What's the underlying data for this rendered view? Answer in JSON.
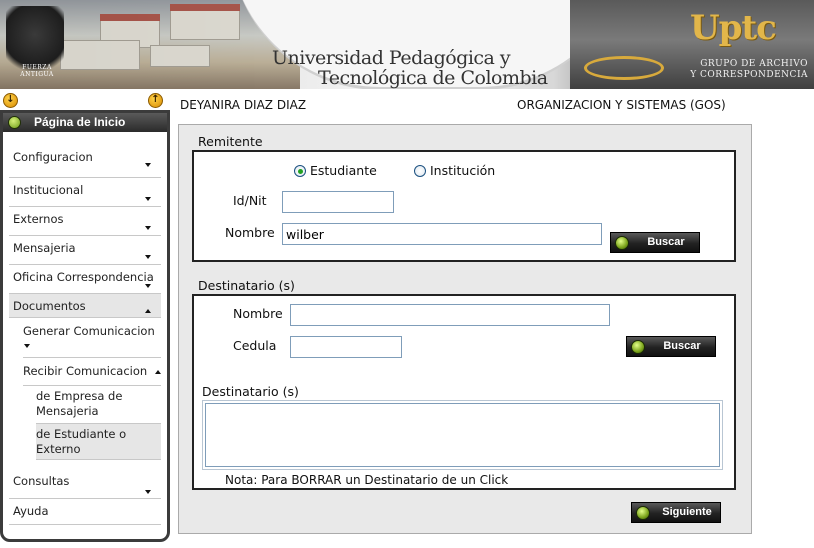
{
  "header": {
    "university_line1": "Universidad Pedagógica y",
    "university_line2": "Tecnológica de Colombia",
    "brand": "Uptc",
    "group_line1": "GRUPO DE ARCHIVO",
    "group_line2": "Y CORRESPONDENCIA"
  },
  "sidebar": {
    "home": "Página de Inicio",
    "items": [
      {
        "label": "Configuracion"
      },
      {
        "label": "Institucional"
      },
      {
        "label": "Externos"
      },
      {
        "label": "Mensajeria"
      },
      {
        "label": "Oficina Correspondencia"
      },
      {
        "label": "Documentos"
      },
      {
        "label": "Generar Comunicacion"
      },
      {
        "label": "Recibir Comunicacion"
      },
      {
        "label": "de Empresa de Mensajeria"
      },
      {
        "label": "de Estudiante o Externo"
      },
      {
        "label": "Consultas"
      },
      {
        "label": "Ayuda"
      }
    ]
  },
  "user": {
    "name": "DEYANIRA DIAZ DIAZ",
    "department": "ORGANIZACION Y SISTEMAS (GOS)"
  },
  "remitente": {
    "title": "Remitente",
    "radio_estudiante": "Estudiante",
    "radio_institucion": "Institución",
    "selected": "Estudiante",
    "id_label": "Id/Nit",
    "id_value": "",
    "nombre_label": "Nombre",
    "nombre_value": "wilber",
    "buscar": "Buscar"
  },
  "destinatario": {
    "title": "Destinatario (s)",
    "nombre_label": "Nombre",
    "nombre_value": "",
    "cedula_label": "Cedula",
    "cedula_value": "",
    "buscar": "Buscar",
    "list_title": "Destinatario (s)",
    "note": "Nota: Para BORRAR un Destinatario de un Click"
  },
  "actions": {
    "siguiente": "Siguiente"
  }
}
